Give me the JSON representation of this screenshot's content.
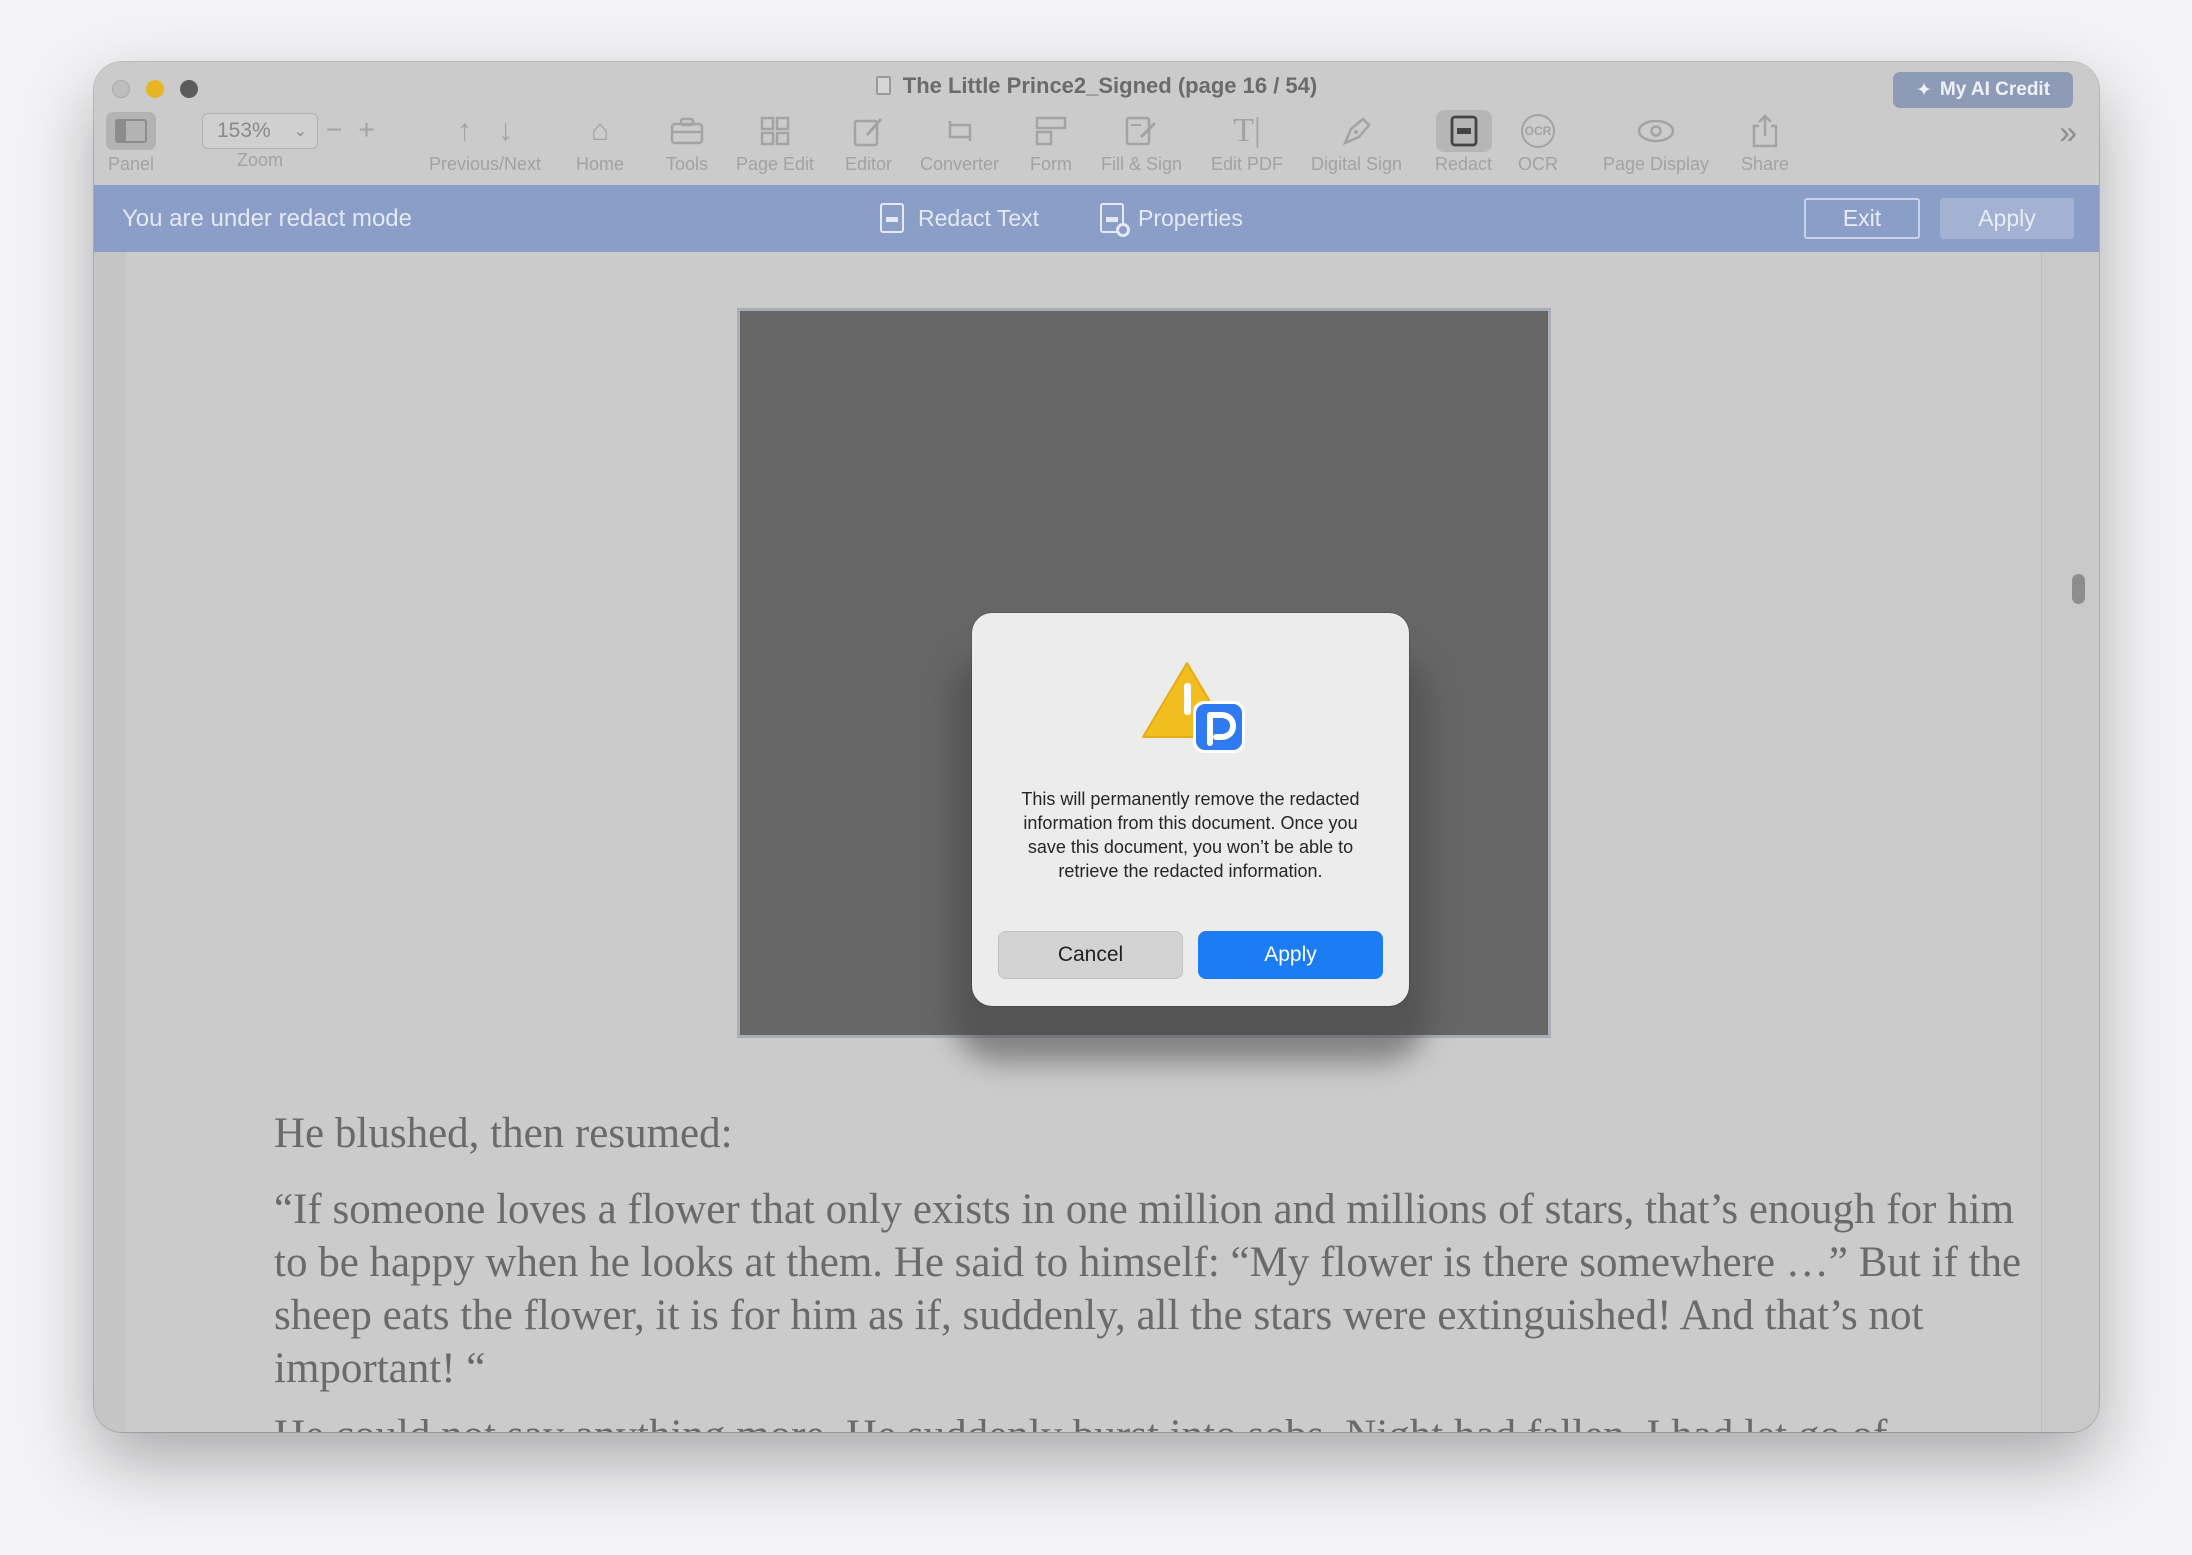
{
  "window": {
    "title": "The Little Prince2_Signed (page 16 / 54)",
    "ai_credit": "My AI Credit"
  },
  "toolbar": {
    "panel": "Panel",
    "zoom_value": "153%",
    "zoom": "Zoom",
    "prev_next": "Previous/Next",
    "home": "Home",
    "tools": "Tools",
    "page_edit": "Page Edit",
    "editor": "Editor",
    "converter": "Converter",
    "form": "Form",
    "fill_sign": "Fill & Sign",
    "edit_pdf": "Edit PDF",
    "digital_sign": "Digital Sign",
    "redact": "Redact",
    "ocr": "OCR",
    "ocr_glyph": "OCR",
    "page_display": "Page Display",
    "share": "Share"
  },
  "redact_bar": {
    "message": "You are under redact mode",
    "redact_text": "Redact Text",
    "properties": "Properties",
    "exit": "Exit",
    "apply": "Apply"
  },
  "document": {
    "para1": "He blushed, then resumed:",
    "para2": "“If someone loves a flower that only exists in one million and millions of stars, that’s enough for him to be happy when he looks at them. He said to himself: “My flower is there somewhere …” But if the sheep eats the flower, it is for him as if, suddenly, all the stars were extinguished! And that’s not important! “",
    "para3": "He could not say anything more. He suddenly burst into sobs. Night had fallen. I had let go of"
  },
  "dialog": {
    "message": "This will permanently remove the redacted information from this document. Once you save this document, you won’t be able to retrieve the redacted information.",
    "cancel": "Cancel",
    "apply": "Apply"
  },
  "colors": {
    "redact_bar": "#8a9ec8",
    "apply_button": "#1c7cf4",
    "warning_yellow": "#f2bd1e",
    "app_badge_blue": "#2f7af0"
  }
}
